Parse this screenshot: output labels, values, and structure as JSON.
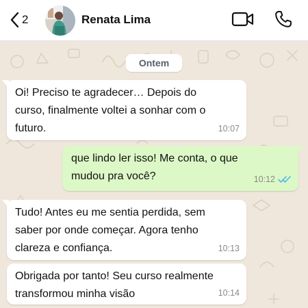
{
  "header": {
    "back_count": "2",
    "contact_name": "Renata Lima"
  },
  "chat": {
    "date_label": "Ontem",
    "messages": [
      {
        "direction": "incoming",
        "text": "Oi! Preciso te agradecer… Depois do\ncurso, finalmente voltei a sonhar com o\nfuturo.",
        "time": "10:07"
      },
      {
        "direction": "outgoing",
        "text": "que lindo ler isso! Me conta, o que\nmudou pra você?",
        "time": "10:12",
        "status": "read"
      },
      {
        "direction": "incoming",
        "text": "Tudo! Antes eu me sentia perdida, sem\nsaber por onde começar. Agora tenho\nclareza e confiança.",
        "time": "10:13"
      },
      {
        "direction": "incoming",
        "text": "Obrigada por tanto! Seu curso realmente\ntransformou minha visão",
        "time": "10:14"
      }
    ]
  },
  "colors": {
    "incoming_bubble": "#ffffff",
    "outgoing_bubble": "#dcf8c6",
    "read_ticks": "#4fb6ec",
    "chat_background": "#efe7dc"
  },
  "icons": [
    "chevron-left-icon",
    "video-camera-icon",
    "phone-icon",
    "double-check-icon"
  ]
}
